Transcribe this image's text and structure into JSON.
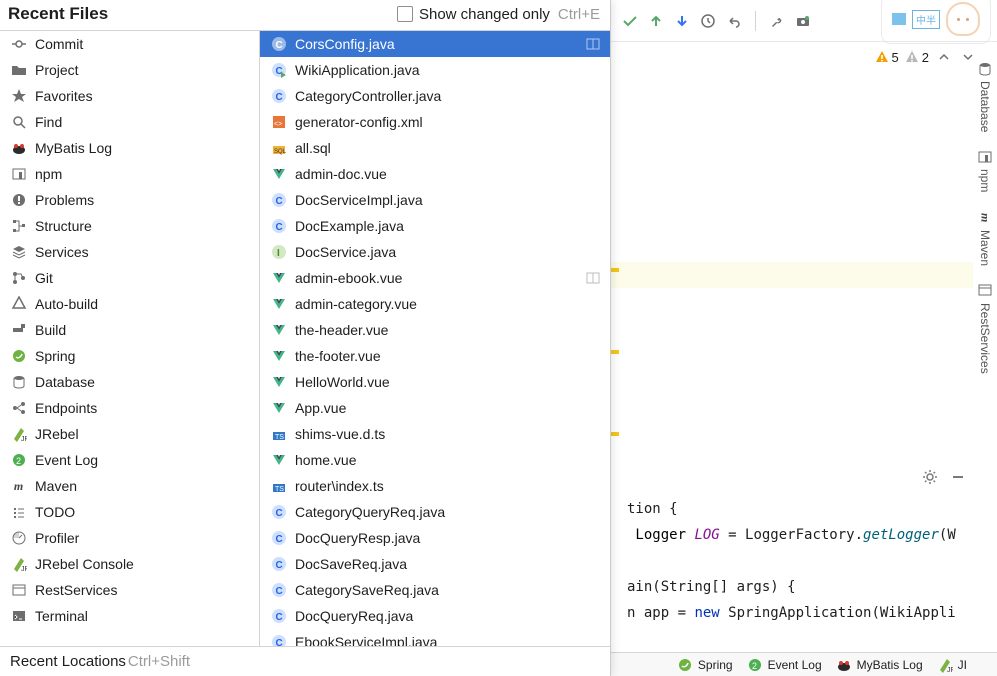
{
  "header": {
    "title": "Recent Files",
    "checkbox_label": "Show changed only",
    "shortcut": "Ctrl+E"
  },
  "footer": {
    "label": "Recent Locations",
    "shortcut": "Ctrl+Shift"
  },
  "tools": [
    {
      "label": "Commit",
      "icon": "commit"
    },
    {
      "label": "Project",
      "icon": "folder"
    },
    {
      "label": "Favorites",
      "icon": "star"
    },
    {
      "label": "Find",
      "icon": "search"
    },
    {
      "label": "MyBatis Log",
      "icon": "mybatis"
    },
    {
      "label": "npm",
      "icon": "npm"
    },
    {
      "label": "Problems",
      "icon": "problems"
    },
    {
      "label": "Structure",
      "icon": "structure"
    },
    {
      "label": "Services",
      "icon": "services"
    },
    {
      "label": "Git",
      "icon": "git"
    },
    {
      "label": "Auto-build",
      "icon": "autobuild"
    },
    {
      "label": "Build",
      "icon": "build"
    },
    {
      "label": "Spring",
      "icon": "spring"
    },
    {
      "label": "Database",
      "icon": "database"
    },
    {
      "label": "Endpoints",
      "icon": "endpoints"
    },
    {
      "label": "JRebel",
      "icon": "jrebel"
    },
    {
      "label": "Event Log",
      "icon": "eventlog"
    },
    {
      "label": "Maven",
      "icon": "maven"
    },
    {
      "label": "TODO",
      "icon": "todo"
    },
    {
      "label": "Profiler",
      "icon": "profiler"
    },
    {
      "label": "JRebel Console",
      "icon": "jrebelc"
    },
    {
      "label": "RestServices",
      "icon": "rest"
    },
    {
      "label": "Terminal",
      "icon": "terminal"
    }
  ],
  "files": [
    {
      "label": "CorsConfig.java",
      "icon": "class",
      "selected": true,
      "split": true
    },
    {
      "label": "WikiApplication.java",
      "icon": "class-run"
    },
    {
      "label": "CategoryController.java",
      "icon": "class"
    },
    {
      "label": "generator-config.xml",
      "icon": "xml"
    },
    {
      "label": "all.sql",
      "icon": "sql"
    },
    {
      "label": "admin-doc.vue",
      "icon": "vue"
    },
    {
      "label": "DocServiceImpl.java",
      "icon": "class"
    },
    {
      "label": "DocExample.java",
      "icon": "class"
    },
    {
      "label": "DocService.java",
      "icon": "interface"
    },
    {
      "label": "admin-ebook.vue",
      "icon": "vue",
      "split": true
    },
    {
      "label": "admin-category.vue",
      "icon": "vue"
    },
    {
      "label": "the-header.vue",
      "icon": "vue"
    },
    {
      "label": "the-footer.vue",
      "icon": "vue"
    },
    {
      "label": "HelloWorld.vue",
      "icon": "vue"
    },
    {
      "label": "App.vue",
      "icon": "vue"
    },
    {
      "label": "shims-vue.d.ts",
      "icon": "ts"
    },
    {
      "label": "home.vue",
      "icon": "vue"
    },
    {
      "label": "router\\index.ts",
      "icon": "ts"
    },
    {
      "label": "CategoryQueryReq.java",
      "icon": "class"
    },
    {
      "label": "DocQueryResp.java",
      "icon": "class"
    },
    {
      "label": "DocSaveReq.java",
      "icon": "class"
    },
    {
      "label": "CategorySaveReq.java",
      "icon": "class"
    },
    {
      "label": "DocQueryReq.java",
      "icon": "class"
    },
    {
      "label": "EbookServiceImpl.java",
      "icon": "class"
    }
  ],
  "warnings": {
    "yellow": "5",
    "gray": "2"
  },
  "right_tools": [
    "Database",
    "npm",
    "Maven",
    "RestServices"
  ],
  "status": [
    "Spring",
    "Event Log",
    "MyBatis Log",
    "JI"
  ],
  "code": {
    "l1": "tion {",
    "l2_a": " Logger ",
    "l2_b": "LOG",
    "l2_c": " = LoggerFactory.",
    "l2_d": "getLogger",
    "l2_e": "(W",
    "l3_a": "ain(String[] args) {",
    "l4_a": "n app = ",
    "l4_b": "new",
    "l4_c": " SpringApplication(WikiAppli"
  },
  "mascot": {
    "cn": "中半"
  }
}
